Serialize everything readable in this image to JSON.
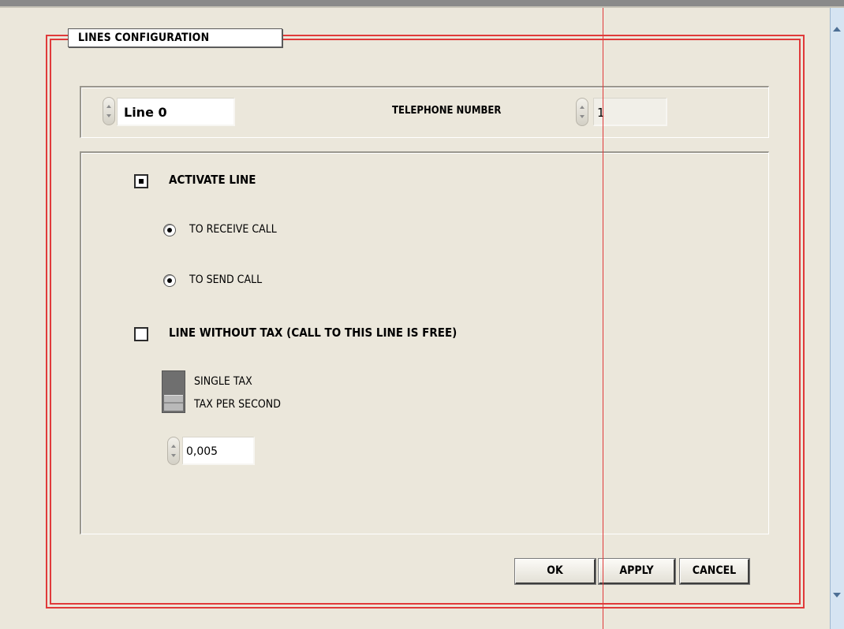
{
  "frame": {
    "title": "LINES CONFIGURATION"
  },
  "line_selector": {
    "value": "Line 0"
  },
  "telephone": {
    "label": "TELEPHONE NUMBER",
    "value": "1"
  },
  "activate_line": {
    "label": "ACTIVATE LINE",
    "checked": true
  },
  "receive_call": {
    "label": "TO RECEIVE CALL",
    "selected": true
  },
  "send_call": {
    "label": "TO SEND CALL",
    "selected": true
  },
  "line_without_tax": {
    "label": "LINE WITHOUT TAX  (CALL TO THIS LINE IS FREE)",
    "checked": false
  },
  "tax_mode": {
    "option_top": "SINGLE TAX",
    "option_bottom": "TAX PER SECOND",
    "selected": "TAX PER SECOND"
  },
  "tax_value": {
    "value": "0,005"
  },
  "buttons": {
    "ok": "OK",
    "apply": "APPLY",
    "cancel": "CANCEL"
  },
  "colors": {
    "frame_red": "#e03a3a",
    "background": "#ebe7db"
  },
  "icons": {
    "spinner": "spinner-arrows-icon",
    "scroll_up": "scroll-up-arrow-icon",
    "scroll_down": "scroll-down-arrow-icon"
  }
}
